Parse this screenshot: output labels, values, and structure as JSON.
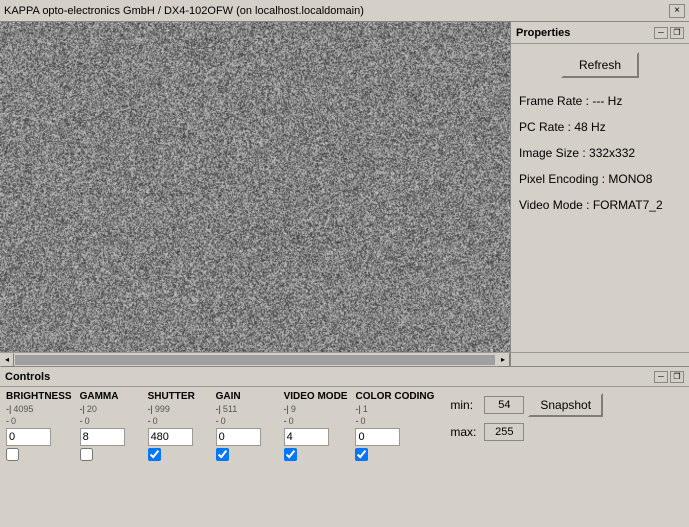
{
  "window": {
    "title": "KAPPA opto-electronics GmbH / DX4-102OFW (on localhost.localdomain)",
    "close_label": "×"
  },
  "properties": {
    "title": "Properties",
    "refresh_label": "Refresh",
    "panel_min": "─",
    "panel_restore": "❐",
    "frame_rate_label": "Frame Rate : --- Hz",
    "pc_rate_label": "PC Rate : 48 Hz",
    "image_size_label": "Image Size : 332x332",
    "pixel_encoding_label": "Pixel Encoding : MONO8",
    "video_mode_label": "Video Mode : FORMAT7_2"
  },
  "controls": {
    "title": "Controls",
    "panel_min": "─",
    "panel_restore": "❐",
    "groups": [
      {
        "label": "BRIGHTNESS",
        "max_val": "4095",
        "min_val": "0",
        "input_val": "0",
        "checkbox_checked": false
      },
      {
        "label": "GAMMA",
        "max_val": "20",
        "min_val": "0",
        "input_val": "8",
        "checkbox_checked": false
      },
      {
        "label": "SHUTTER",
        "max_val": "999",
        "min_val": "0",
        "input_val": "480",
        "checkbox_checked": true
      },
      {
        "label": "GAIN",
        "max_val": "511",
        "min_val": "0",
        "input_val": "0",
        "checkbox_checked": true
      },
      {
        "label": "VIDEO MODE",
        "max_val": "9",
        "min_val": "0",
        "input_val": "4",
        "checkbox_checked": true
      },
      {
        "label": "COLOR CODING",
        "max_val": "1",
        "min_val": "0",
        "input_val": "0",
        "checkbox_checked": true
      }
    ],
    "min_label": "min:",
    "max_label": "max:",
    "min_val": "54",
    "max_val": "255",
    "snapshot_label": "Snapshot"
  }
}
